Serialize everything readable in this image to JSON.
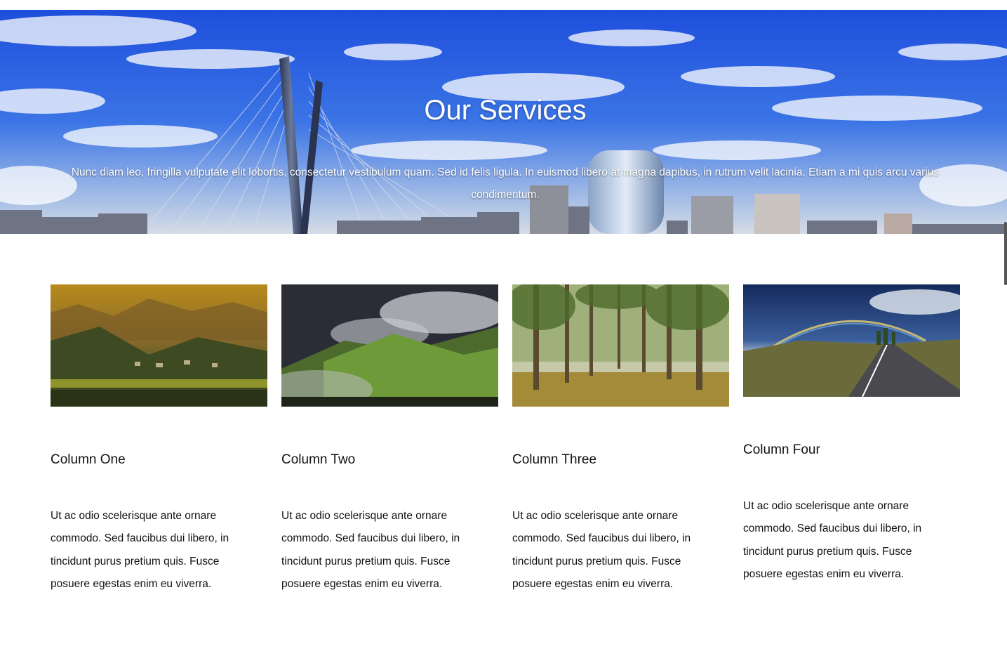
{
  "hero": {
    "title": "Our Services",
    "subtitle": "Nunc diam leo, fringilla vulputate elit lobortis, consectetur vestibulum quam. Sed id felis ligula. In euismod libero at magna dapibus, in rutrum velit lacinia. Etiam a mi quis arcu varius condimentum.",
    "image": "city-bridge-skyline-photo"
  },
  "columns": [
    {
      "title": "Column One",
      "text": "Ut ac odio scelerisque ante ornare commodo. Sed faucibus dui libero, in tincidunt purus pretium quis. Fusce posuere egestas enim eu viverra.",
      "image": "golden-mountain-valley-photo"
    },
    {
      "title": "Column Two",
      "text": "Ut ac odio scelerisque ante ornare commodo. Sed faucibus dui libero, in tincidunt purus pretium quis. Fusce posuere egestas enim eu viverra.",
      "image": "misty-green-hills-photo"
    },
    {
      "title": "Column Three",
      "text": "Ut ac odio scelerisque ante ornare commodo. Sed faucibus dui libero, in tincidunt purus pretium quis. Fusce posuere egestas enim eu viverra.",
      "image": "forest-trees-photo"
    },
    {
      "title": "Column Four",
      "text": "Ut ac odio scelerisque ante ornare commodo. Sed faucibus dui libero, in tincidunt purus pretium quis. Fusce posuere egestas enim eu viverra.",
      "image": "rainbow-road-photo"
    }
  ]
}
